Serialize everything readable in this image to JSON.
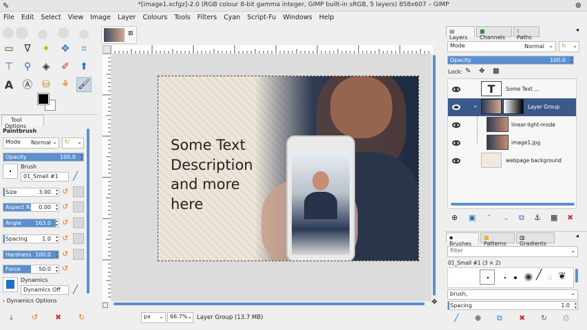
{
  "window": {
    "title": "*[image1.xcfgz]-2.0 (RGB colour 8-bit gamma integer, GIMP built-in sRGB, 5 layers) 858x607 – GIMP"
  },
  "menu": [
    "File",
    "Edit",
    "Select",
    "View",
    "Image",
    "Layer",
    "Colours",
    "Tools",
    "Filters",
    "Cyan",
    "Script-Fu",
    "Windows",
    "Help"
  ],
  "tool_options": {
    "tab_label": "Tool Options",
    "tool_name": "Paintbrush",
    "mode_label": "Mode",
    "mode_value": "Normal",
    "opacity_label": "Opacity",
    "opacity_value": "100.0",
    "opacity_fraction": 1.0,
    "brush_label": "Brush",
    "brush_value": "01_Small #1",
    "size_label": "Size",
    "size_value": "3.00",
    "aspect_label": "Aspect Ratio",
    "aspect_value": "0.00",
    "angle_label": "Angle",
    "angle_value": "163.0",
    "spacing_label": "Spacing",
    "spacing_value": "1.0",
    "hardness_label": "Hardness",
    "hardness_value": "100.0",
    "force_label": "Force",
    "force_value": "50.0",
    "dynamics_label": "Dynamics",
    "dynamics_value": "Dynamics Off",
    "dynamics_options": "Dynamics Options"
  },
  "canvas": {
    "text_lines": [
      "Some Text",
      "Description",
      "and more",
      "here"
    ],
    "unit": "px",
    "zoom": "66.7%",
    "status": "Layer Group (13.7 MB)"
  },
  "layers": {
    "tabs": [
      "Layers",
      "Channels",
      "Paths"
    ],
    "mode_label": "Mode",
    "mode_value": "Normal",
    "opacity_label": "Opacity",
    "opacity_value": "100.0",
    "lock_label": "Lock:",
    "items": [
      {
        "name": "Some Text ..."
      },
      {
        "name": "Layer Group"
      },
      {
        "name": "linear-light-mode"
      },
      {
        "name": "image1.jpg"
      },
      {
        "name": "webpage background"
      }
    ]
  },
  "brushes": {
    "tabs": [
      "Brushes",
      "Patterns",
      "Gradients"
    ],
    "filter_placeholder": "filter",
    "current": "01_Small #1 (3 × 2)",
    "tag_value": "brush,",
    "spacing_label": "Spacing",
    "spacing_value": "1.0"
  }
}
